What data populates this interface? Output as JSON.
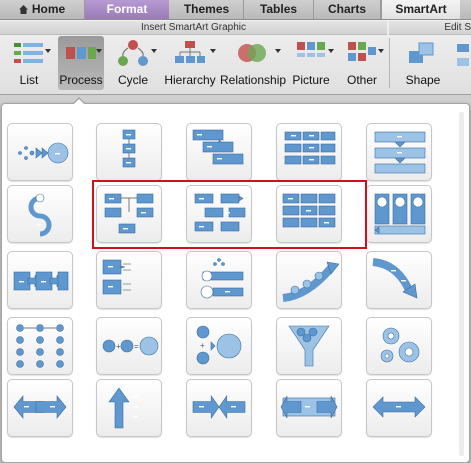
{
  "tabs": [
    {
      "id": "home",
      "label": "Home"
    },
    {
      "id": "format",
      "label": "Format"
    },
    {
      "id": "themes",
      "label": "Themes"
    },
    {
      "id": "tables",
      "label": "Tables"
    },
    {
      "id": "charts",
      "label": "Charts"
    },
    {
      "id": "smartart",
      "label": "SmartArt"
    }
  ],
  "ribbon": {
    "group_title": "Insert SmartArt Graphic",
    "group2_title": "Edit S",
    "buttons": [
      {
        "id": "list",
        "label": "List"
      },
      {
        "id": "process",
        "label": "Process"
      },
      {
        "id": "cycle",
        "label": "Cycle"
      },
      {
        "id": "hierarchy",
        "label": "Hierarchy"
      },
      {
        "id": "relationship",
        "label": "Relationship"
      },
      {
        "id": "picture",
        "label": "Picture"
      },
      {
        "id": "other",
        "label": "Other"
      },
      {
        "id": "shape",
        "label": "Shape"
      }
    ]
  },
  "colors": {
    "format_tab": "#9a7bb8",
    "shape_fill": "#5f97cf",
    "selection_outline": "#d0101a"
  },
  "gallery": {
    "layouts": [
      "basic-bending-process",
      "vertical-process",
      "staggered-process",
      "vertical-equation-process",
      "downward-arrow-process",
      "circular-arrow-process",
      "alternating-flow",
      "segmented-process",
      "continuous-process",
      "process-with-pictures",
      "accent-process",
      "detailed-process",
      "basic-timeline",
      "upward-arrow",
      "descending-arrow",
      "circle-process",
      "equation",
      "vertical-equation",
      "funnel",
      "gear",
      "opposing-arrows",
      "divergent-arrows",
      "converging-arrows",
      "arrow-ribbon",
      "balance-arrows"
    ],
    "selected_layouts": [
      "alternating-flow",
      "segmented-process",
      "continuous-process"
    ]
  }
}
